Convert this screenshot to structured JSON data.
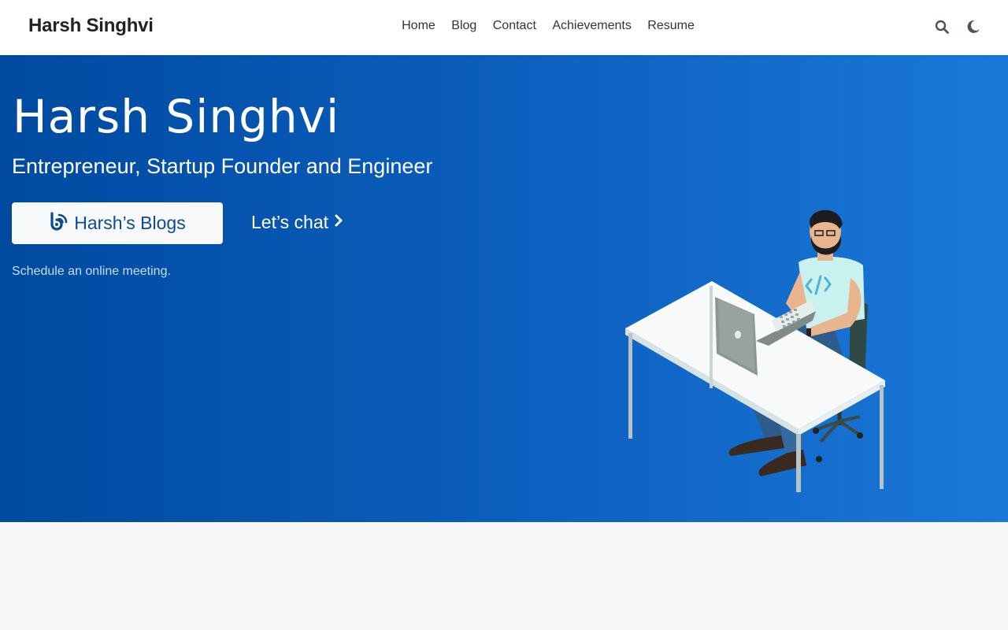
{
  "navbar": {
    "brand": "Harsh Singhvi",
    "links": [
      {
        "label": "Home"
      },
      {
        "label": "Blog"
      },
      {
        "label": "Contact"
      },
      {
        "label": "Achievements"
      },
      {
        "label": "Resume"
      }
    ],
    "icons": [
      "search-icon",
      "moon-icon"
    ]
  },
  "hero": {
    "title": "Harsh Singhvi",
    "subtitle": "Entrepreneur, Startup Founder and Engineer",
    "primary_button": {
      "label": "Harsh’s Blogs",
      "icon": "blog-icon"
    },
    "secondary_button": {
      "label": "Let’s chat",
      "icon": "chevron-right-icon"
    },
    "note": "Schedule an online meeting.",
    "illustration": "developer-at-desk-illustration"
  },
  "colors": {
    "hero_gradient_start": "#004aa0",
    "hero_gradient_end": "#1a78d8",
    "primary_button_text": "#0d4a8f",
    "navbar_bg": "#ffffff",
    "page_bg": "#f6f6f6"
  }
}
